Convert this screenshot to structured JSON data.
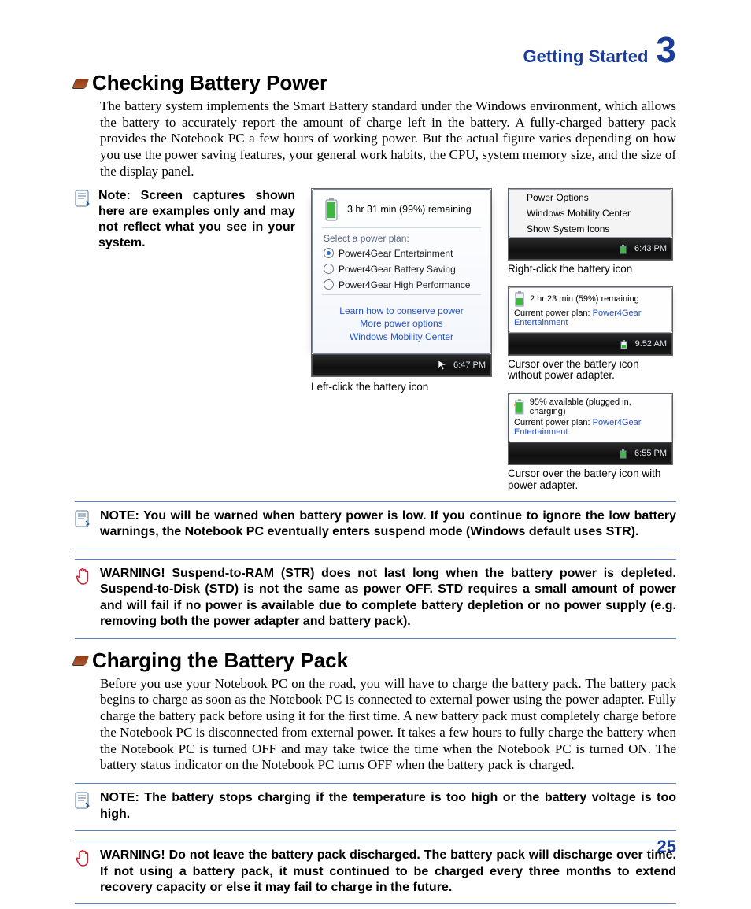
{
  "chapter": {
    "title": "Getting Started",
    "number": "3"
  },
  "page_number": "25",
  "section1": {
    "icon": "battery-section-icon",
    "heading": "Checking Battery Power",
    "body": "The battery system implements the Smart Battery standard under the Windows environment, which allows the battery to accurately report the amount of charge left in the battery. A fully-charged battery pack provides the Notebook PC a few hours of working power. But the actual figure varies depending on how you use the power saving features, your general work habits, the CPU, system memory size, and the size of the display panel.",
    "sidenote": "Note: Screen captures shown here are examples only and may not reflect what you see in your system."
  },
  "flyout": {
    "status": "3 hr 31 min (99%) remaining",
    "plan_label": "Select a power plan:",
    "plans": [
      "Power4Gear Entertainment",
      "Power4Gear Battery Saving",
      "Power4Gear High Performance"
    ],
    "selected_plan_index": 0,
    "links": [
      "Learn how to conserve power",
      "More power options",
      "Windows Mobility Center"
    ],
    "taskbar_time": "6:47 PM",
    "caption": "Left-click the battery icon"
  },
  "ctxmenu": {
    "items": [
      "Power Options",
      "Windows Mobility Center",
      "Show System Icons"
    ],
    "taskbar_time": "6:43 PM",
    "caption": "Right-click the battery icon"
  },
  "tooltip_no_adapter": {
    "line1": "2 hr 23 min (59%) remaining",
    "plan_label": "Current power plan:",
    "plan_value": "Power4Gear Entertainment",
    "taskbar_time": "9:52 AM",
    "caption": "Cursor over the battery icon without power adapter."
  },
  "tooltip_with_adapter": {
    "line1": "95% available (plugged in, charging)",
    "plan_label": "Current power plan:",
    "plan_value": "Power4Gear Entertainment",
    "taskbar_time": "6:55 PM",
    "caption": "Cursor over the battery icon with power adapter."
  },
  "note1": "NOTE:  You will be warned when battery power is low. If you continue to ignore the low battery warnings, the Notebook PC eventually enters suspend mode (Windows default uses STR).",
  "warn1": "WARNING!  Suspend-to-RAM (STR) does not last long when the battery power is depleted. Suspend-to-Disk (STD) is not the same as power OFF. STD requires a small amount of power and will fail if no power is available due to complete battery depletion or no power supply (e.g. removing both the power adapter and battery pack).",
  "section2": {
    "heading": "Charging the Battery Pack",
    "body": "Before you use your Notebook PC on the road, you will have to charge the battery pack. The battery pack begins to charge as soon as the Notebook PC is connected to external power using the power adapter. Fully charge the battery pack before using it for the first time. A new battery pack must completely charge before the Notebook PC is disconnected from external power. It takes a few hours to fully charge the battery when the Notebook PC is turned OFF and may take twice the time when the Notebook PC is turned ON. The battery status indicator on the Notebook PC turns OFF when the battery pack is charged."
  },
  "note2": "NOTE: The battery stops charging if the temperature is too high or the battery voltage is too high.",
  "warn2": "WARNING!  Do not leave the battery pack discharged. The battery pack will discharge over time. If not using a battery pack, it must continued to be charged every three months to extend recovery capacity or else it may fail to charge in the future."
}
